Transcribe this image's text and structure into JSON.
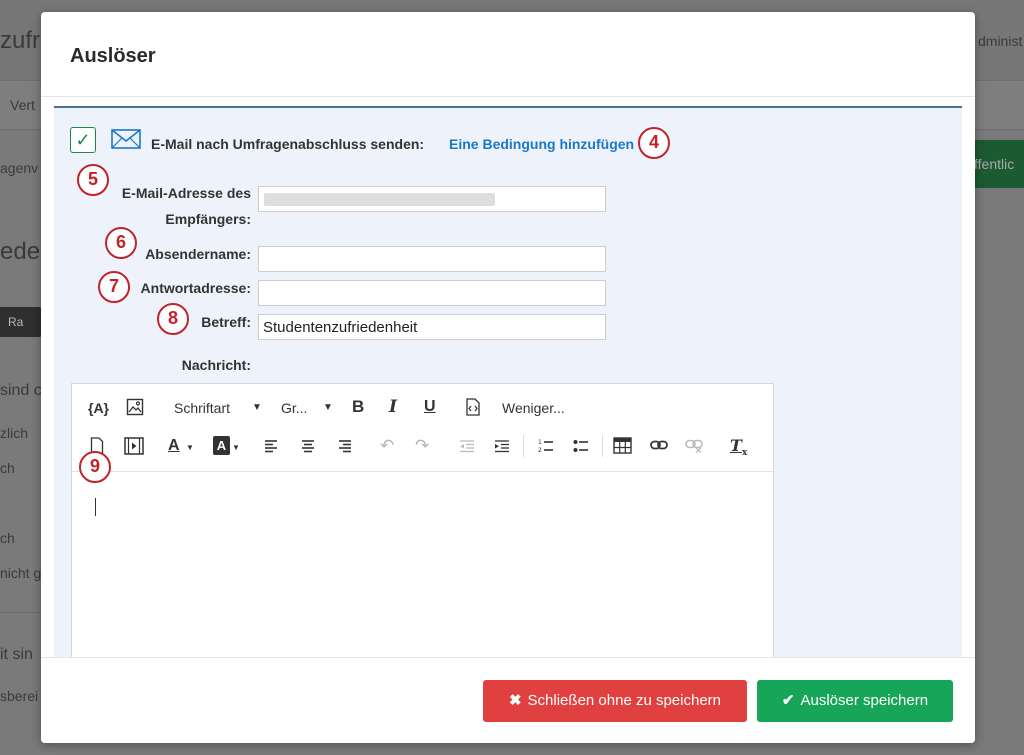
{
  "background": {
    "texts": [
      "zufri",
      "Vert",
      "agenv",
      "eder",
      "Ra",
      "sind c",
      "zlich",
      "ch",
      "ch",
      "nicht g",
      "it sin",
      "sberei",
      "dminist",
      "ffentlic"
    ]
  },
  "modal": {
    "title": "Auslöser",
    "action_label": "E-Mail nach Umfragenabschluss senden:",
    "add_condition_link": "Eine Bedingung hinzufügen",
    "fields": {
      "recipient_label_line1": "E-Mail-Adresse des",
      "recipient_label_line2": "Empfängers:",
      "sender_name_label": "Absendername:",
      "reply_to_label": "Antwortadresse:",
      "subject_label": "Betreff:",
      "subject_value": "Studentenzufriedenheit",
      "message_label": "Nachricht:"
    },
    "toolbar": {
      "piped_text": "{A}",
      "font_select": "Schriftart",
      "size_select": "Gr...",
      "bold": "B",
      "italic": "I",
      "underline": "U",
      "less": "Weniger...",
      "text_color": "A",
      "bg_color": "A",
      "clear_format": "T"
    },
    "footer": {
      "close_without_save": "Schließen ohne zu speichern",
      "save_trigger": "Auslöser speichern"
    }
  },
  "callouts": [
    "4",
    "5",
    "6",
    "7",
    "8",
    "9"
  ],
  "colors": {
    "accent_link": "#1a78c8",
    "danger": "#e04040",
    "success": "#17a55a",
    "callout": "#c0232a"
  }
}
